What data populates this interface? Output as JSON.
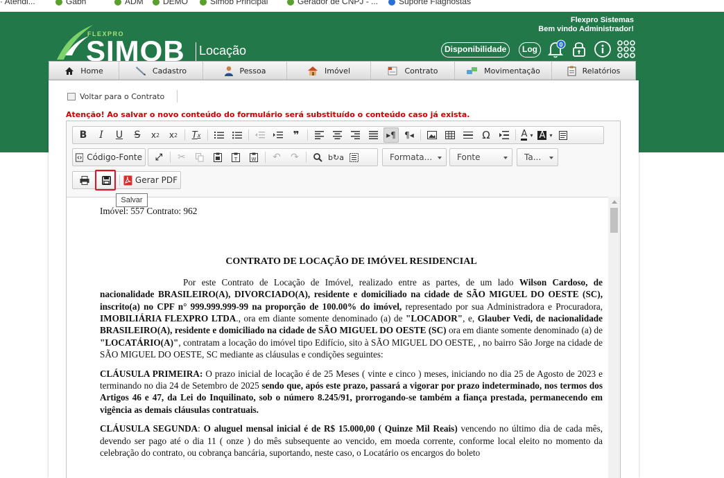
{
  "bookmarks": [
    "· Atendi...",
    "Gabh",
    "ADM",
    "DEMO",
    "Simob Principal",
    "Gerador de CNPJ - ...",
    "Suporte Flagnostas"
  ],
  "brand": {
    "flexpro": "FLEXPRO",
    "simob": "SIMOB",
    "module": "Locação",
    "company": "Flexpro Sistemas",
    "welcome": "Bem vindo Administrador!"
  },
  "header_buttons": {
    "availability": "Disponibilidade",
    "log": "Log",
    "notification_count": "0"
  },
  "nav": [
    {
      "label": "Home",
      "icon": "home-icon"
    },
    {
      "label": "Cadastro",
      "icon": "pencil-icon"
    },
    {
      "label": "Pessoa",
      "icon": "person-icon"
    },
    {
      "label": "Imóvel",
      "icon": "house-icon"
    },
    {
      "label": "Contrato",
      "icon": "contract-icon"
    },
    {
      "label": "Movimentação",
      "icon": "movement-icon"
    },
    {
      "label": "Relatórios",
      "icon": "report-icon"
    }
  ],
  "back_link": "Voltar para o Contrato",
  "warning": "Atenção! Ao salvar o novo conteúdo do formulário será substituído o conteúdo caso já exista.",
  "toolbar": {
    "source": "Código-Fonte",
    "format": "Formata...",
    "font": "Fonte",
    "size": "Ta...",
    "gerar_pdf": "Gerar PDF",
    "tooltip": "Salvar"
  },
  "document": {
    "header": "Imóvel: 557   Contrato: 962",
    "title": "CONTRATO DE LOCAÇÃO DE IMÓVEL RESIDENCIAL",
    "p1_a": "Por este Contrato de Locação de Imóvel, realizado entre as partes, de um lado ",
    "p1_b": "Wilson Cardoso, de nacionalidade BRASILEIRO(A), DIVORCIADO(A), residente e domiciliado na cidade de SÃO MIGUEL DO OESTE (SC), inscrito(a) no CPF n° 999.999.999-99 na proporção de 100.00% do imóvel,",
    "p1_c": " representado por sua Administradora e Procuradora, ",
    "p1_d": "IMOBILIÁRIA FLEXPRO LTDA",
    "p1_e": "., ora em diante somente denominado (a) de ",
    "p1_f": "\"LOCADOR\"",
    "p1_g": ", e, ",
    "p1_h": "Glauber Vedi, de nacionalidade BRASILEIRO(A), residente e domiciliado na cidade de SÃO MIGUEL DO OESTE (SC)",
    "p1_i": " ora em diante somente denominado (a) de ",
    "p1_j": "\"LOCATÁRIO(A)\"",
    "p1_k": ", contratam a locação do imóvel tipo Edifício, sito à SÃO MIGUEL DO OESTE, ,  no bairro São Jorge na cidade de SÃO MIGUEL DO OESTE, SC  mediante as cláusulas e  condições seguintes:",
    "c1_label": "CLÁUSULA PRIMEIRA:",
    "c1_a": " O prazo inicial de locação é de 25 Meses  ( vinte e cinco ) meses, iniciando no dia 25 de Agosto de 2023 e terminando no dia 24 de Setembro de 2025 ",
    "c1_b": "sendo que, após este prazo, passará a vigorar por prazo indeterminado, nos termos dos Artigos 46 e 47, da Lei do Inquilinato, sob o número 8.245/91, prorrogando-se também a fiança prestada, permanecendo em vigência as demais cláusulas contratuais.",
    "c2_label": "CLÁUSULA SEGUNDA",
    "c2_a": ": ",
    "c2_b": "O aluguel mensal inicial é de R$ 15.000,00 ( Quinze Mil Reais)",
    "c2_c": " vencendo no último dia de cada mês, devendo ser pago até o dia 11 ( onze ) do mês subsequente ao vencido, em moeda corrente, conforme local eleito no momento da celebração do contrato, ou cobrança bancária, suportando, neste caso, o Locatário os encargos do boleto"
  }
}
